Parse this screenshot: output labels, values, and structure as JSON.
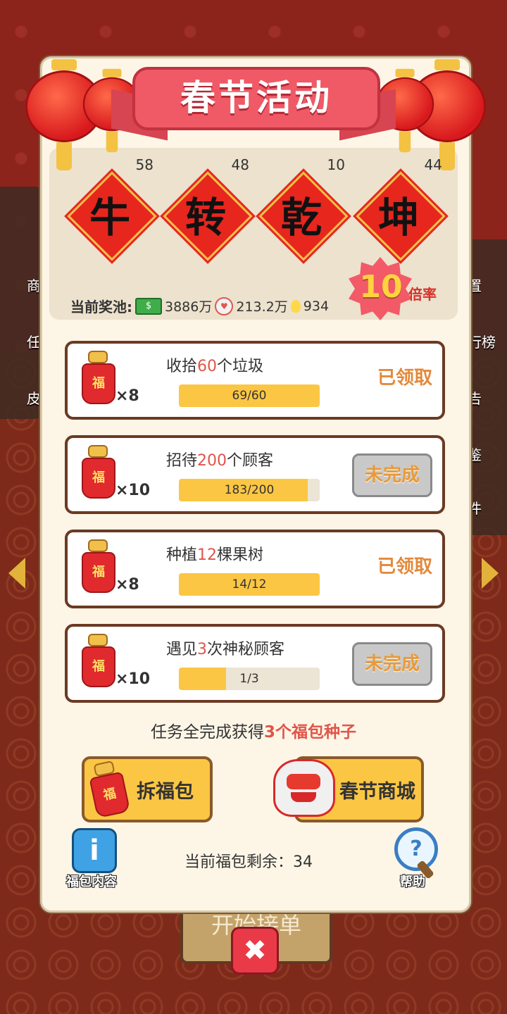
{
  "title": "春节活动",
  "chars": [
    {
      "char": "牛",
      "count": "58"
    },
    {
      "char": "转",
      "count": "48"
    },
    {
      "char": "乾",
      "count": "10"
    },
    {
      "char": "坤",
      "count": "44"
    }
  ],
  "multiplier": {
    "value": "10",
    "label": "倍率"
  },
  "pool": {
    "label": "当前奖池:",
    "cash": "3886万",
    "hearts": "213.2万",
    "bulbs": "934"
  },
  "tasks": [
    {
      "title_pre": "收拾",
      "title_num": "60",
      "title_post": "个垃圾",
      "reward": "×8",
      "progress": "69/60",
      "fill": 1.0,
      "status": "已领取"
    },
    {
      "title_pre": "招待",
      "title_num": "200",
      "title_post": "个顾客",
      "reward": "×10",
      "progress": "183/200",
      "fill": 0.915,
      "status": "未完成"
    },
    {
      "title_pre": "种植",
      "title_num": "12",
      "title_post": "棵果树",
      "reward": "×8",
      "progress": "14/12",
      "fill": 1.0,
      "status": "已领取"
    },
    {
      "title_pre": "遇见",
      "title_num": "3",
      "title_post": "次神秘顾客",
      "reward": "×10",
      "progress": "1/3",
      "fill": 0.333,
      "status": "未完成"
    }
  ],
  "reward_text": {
    "pre": "任务全完成获得",
    "hl": "3个福包种子"
  },
  "bag_char": "福",
  "buttons": {
    "open_bag": "拆福包",
    "mall": "春节商城",
    "info": "福包内容",
    "help": "帮助",
    "close": "✖"
  },
  "remaining": "当前福包剩余：34",
  "background": {
    "start_order": "开始接单",
    "side_labels": [
      "商",
      "任",
      "皮",
      "置",
      "行榜",
      "告",
      "鉴",
      "件"
    ]
  },
  "colors": {
    "accent_red": "#e7261e",
    "gold": "#fbc644",
    "panel": "#fdf6e7"
  }
}
